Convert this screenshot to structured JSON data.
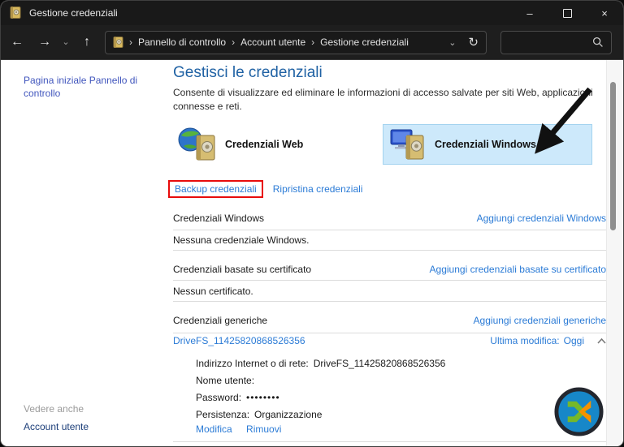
{
  "window": {
    "title": "Gestione credenziali"
  },
  "nav": {
    "back_glyph": "←",
    "forward_glyph": "→",
    "recent_glyph": "⌄",
    "up_glyph": "↑",
    "crumb_separator": "›",
    "breadcrumb": [
      "Pannello di controllo",
      "Account utente",
      "Gestione credenziali"
    ],
    "address_dropdown_glyph": "⌄",
    "refresh_glyph": "↻",
    "search_value": ""
  },
  "sidebar": {
    "home_link": "Pagina iniziale Pannello di controllo",
    "see_also_label": "Vedere anche",
    "account_link": "Account utente"
  },
  "main": {
    "heading": "Gestisci le credenziali",
    "description": "Consente di visualizzare ed eliminare le informazioni di accesso salvate per siti Web, applicazioni connesse e reti.",
    "tiles": [
      {
        "label": "Credenziali Web"
      },
      {
        "label": "Credenziali Windows"
      }
    ],
    "backup_link": "Backup credenziali",
    "restore_link": "Ripristina credenziali",
    "sections": [
      {
        "label": "Credenziali Windows",
        "add_link": "Aggiungi credenziali Windows",
        "empty_text": "Nessuna credenziale Windows."
      },
      {
        "label": "Credenziali basate su certificato",
        "add_link": "Aggiungi credenziali basate su certificato",
        "empty_text": "Nessun certificato."
      },
      {
        "label": "Credenziali generiche",
        "add_link": "Aggiungi credenziali generiche"
      }
    ],
    "credential": {
      "name": "DriveFS_11425820868526356",
      "modified_label": "Ultima modifica:",
      "modified_value": "Oggi",
      "fields": [
        {
          "label": "Indirizzo Internet o di rete:",
          "value": "DriveFS_11425820868526356"
        },
        {
          "label": "Nome utente:",
          "value": ""
        },
        {
          "label": "Password:",
          "value": "••••••••"
        },
        {
          "label": "Persistenza:",
          "value": "Organizzazione"
        }
      ],
      "edit_link": "Modifica",
      "remove_link": "Rimuovi"
    }
  },
  "colors": {
    "link_blue": "#2b7bd6",
    "heading_blue": "#2062a4",
    "sidebar_link_blue": "#4156bd",
    "account_link_navy": "#1c3e79",
    "tile_highlight_bg": "#cde9fb",
    "tile_highlight_border": "#a3d3ef",
    "annotation_red": "#e80c0c",
    "annotation_black": "#111111",
    "logo_blue": "#1787c8",
    "logo_green": "#76b82a",
    "logo_orange": "#f39200"
  }
}
